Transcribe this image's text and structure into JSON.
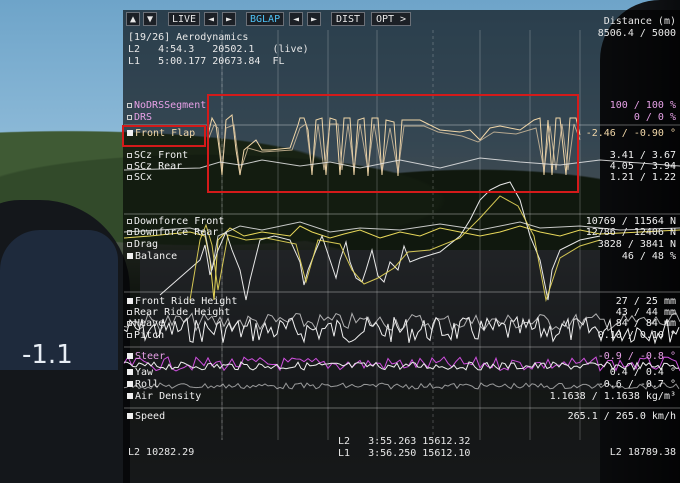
{
  "toolbar": {
    "up_icon": "▲",
    "down_icon": "▼",
    "live_label": "LIVE",
    "prev1": "◄",
    "next1": "►",
    "bglap_label": "BGLAP",
    "prev2": "◄",
    "next2": "►",
    "dist_label": "DIST",
    "opt_label": "OPT >"
  },
  "header": {
    "page": "[19/26] Aerodynamics",
    "lap_l2": "L2   4:54.3   20502.1   (live)",
    "lap_l1": "L1   5:00.177 20673.84  FL",
    "distance_label": "Distance (m)",
    "distance_value": "8506.4 / 5000"
  },
  "channels": [
    {
      "label": "NoDRSSegment",
      "value": "100 / 100 %",
      "color": "#e6a0e6",
      "filled": false
    },
    {
      "label": "DRS",
      "value": "0 / 0 %",
      "color": "#e6a0e6",
      "filled": false
    },
    {
      "label": "Front Flap",
      "value": "-2.46 / -0.90 °",
      "color": "#f0d6a8",
      "filled": true
    },
    {
      "label": "SCz Front",
      "value": "3.41 / 3.67",
      "color": "#f0f0f0",
      "filled": false
    },
    {
      "label": "SCz Rear",
      "value": "4.05 / 3.94",
      "color": "#f0f0f0",
      "filled": false
    },
    {
      "label": "SCx",
      "value": "1.21 / 1.22",
      "color": "#f0f0f0",
      "filled": false
    },
    {
      "label": "Downforce Front",
      "value": "10769 / 11564 N",
      "color": "#f0f0f0",
      "filled": false
    },
    {
      "label": "Downforce Rear",
      "value": "12786 / 12406 N",
      "color": "#f0f0f0",
      "filled": false
    },
    {
      "label": "Drag",
      "value": "3828 / 3841 N",
      "color": "#f0f0f0",
      "filled": false
    },
    {
      "label": "Balance",
      "value": "46 / 48 %",
      "color": "#f0f0f0",
      "filled": true
    },
    {
      "label": "Front Ride Height",
      "value": "27 / 25 mm",
      "color": "#f0f0f0",
      "filled": true
    },
    {
      "label": "Rear Ride Height",
      "value": "43 / 44 mm",
      "color": "#f0f0f0",
      "filled": false
    },
    {
      "label": "Heave",
      "value": "84 / 84 mm",
      "color": "#f0f0f0",
      "filled": false
    },
    {
      "label": "Pitch",
      "value": "0.10 / 0.10 °",
      "color": "#f0f0f0",
      "filled": false
    },
    {
      "label": "Steer",
      "value": "-0.9 / -0.8 °",
      "color": "#e6a0e6",
      "filled": true
    },
    {
      "label": "Yaw",
      "value": "0.4 / 0.4 °",
      "color": "#f0f0f0",
      "filled": true
    },
    {
      "label": "Roll",
      "value": "-0.6 / -0.7 °",
      "color": "#f0f0f0",
      "filled": true
    },
    {
      "label": "Air Density",
      "value": "1.1638 / 1.1638 kg/m³",
      "color": "#f0f0f0",
      "filled": true
    },
    {
      "label": "Speed",
      "value": "265.1 / 265.0 km/h",
      "color": "#f0f0f0",
      "filled": true
    }
  ],
  "footer": {
    "left": "L2 10282.29",
    "center_l2": "L2   3:55.263 15612.32",
    "center_l1": "L1   3:56.250 15612.10",
    "right": "L2 18789.38"
  },
  "seat_digit": "-1.1",
  "colors": {
    "highlight_box": "#d41a1a",
    "trace_light": "#f0d6a8",
    "trace_yellow": "#e8d85a",
    "trace_magenta": "#d050e0"
  }
}
